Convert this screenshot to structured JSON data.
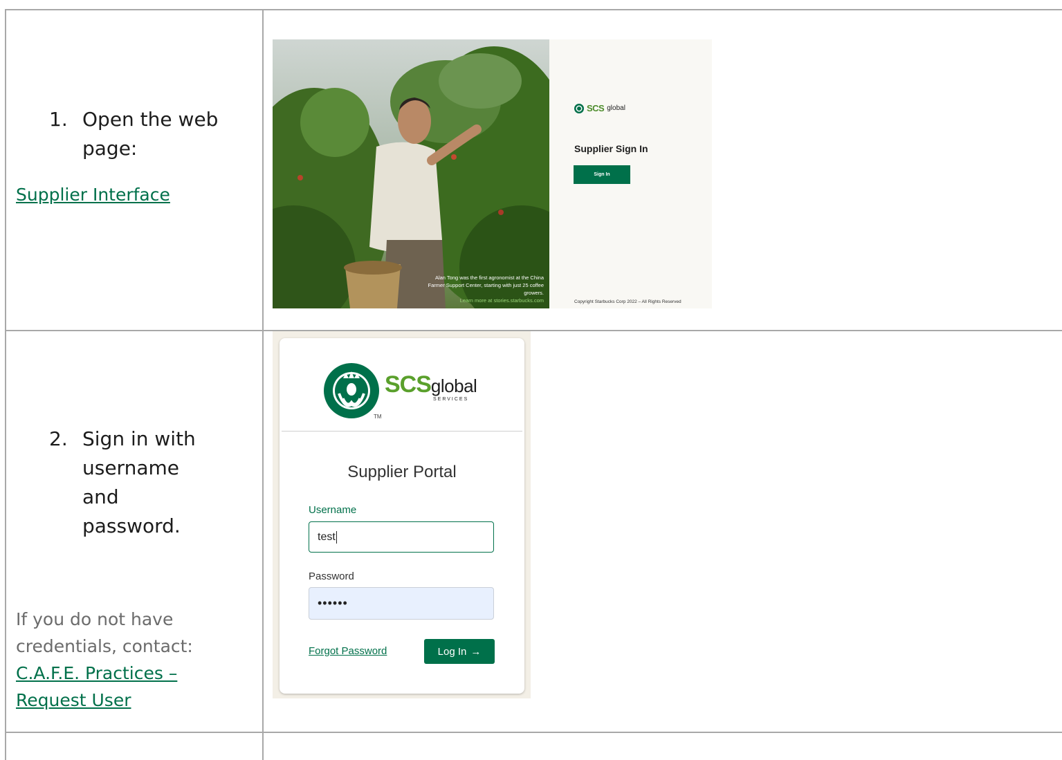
{
  "rows": [
    {
      "number": "1.",
      "instruction": "Open the web page:",
      "link": "Supplier Interface"
    },
    {
      "number": "2.",
      "instruction": "Sign in with username and password.",
      "note": "If you do not have credentials, contact:",
      "note_link": "C.A.F.E. Practices – Request User"
    }
  ],
  "screenshot1": {
    "logo_scs": "SCS",
    "logo_global": "global",
    "title": "Supplier Sign In",
    "button": "Sign In",
    "caption": "Alan Tong was the first agronomist at the China Farmer Support Center, starting with just 25 coffee growers.",
    "caption_link": "Learn more at stories.starbucks.com",
    "copyright": "Copyright Starbucks Corp 2022 – All Rights Reserved"
  },
  "screenshot2": {
    "logo_scs": "SCS",
    "logo_global": "global",
    "logo_services": "SERVICES",
    "logo_tm": "TM",
    "title": "Supplier Portal",
    "username_label": "Username",
    "username_value": "test",
    "password_label": "Password",
    "password_value": "••••••",
    "forgot": "Forgot Password",
    "login": "Log In",
    "login_arrow": "→"
  },
  "colors": {
    "brand_green": "#00704a",
    "logo_green": "#4c8c2b",
    "autofill_blue": "#e8f0fe"
  }
}
